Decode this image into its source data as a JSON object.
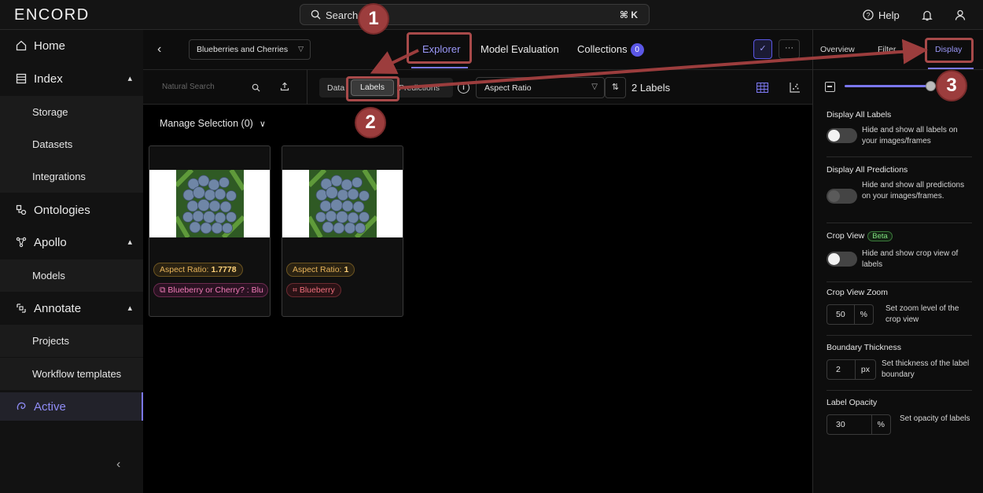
{
  "app": {
    "logo": "ENCORD",
    "search_label": "Search",
    "search_shortcut": "⌘ K",
    "help_label": "Help"
  },
  "sidebar": {
    "items": [
      {
        "label": "Home"
      },
      {
        "label": "Index"
      },
      {
        "label": "Storage"
      },
      {
        "label": "Datasets"
      },
      {
        "label": "Integrations"
      },
      {
        "label": "Ontologies"
      },
      {
        "label": "Apollo"
      },
      {
        "label": "Models"
      },
      {
        "label": "Annotate"
      },
      {
        "label": "Projects"
      },
      {
        "label": "Workflow templates"
      },
      {
        "label": "Active"
      }
    ]
  },
  "main": {
    "dataset": "Blueberries and Cherries",
    "tabs": [
      {
        "label": "Explorer"
      },
      {
        "label": "Model Evaluation"
      },
      {
        "label": "Collections",
        "badge": "0"
      }
    ],
    "natural_search_placeholder": "Natural Search",
    "segments": {
      "data": "Data",
      "labels": "Labels",
      "predictions": "Predictions"
    },
    "sort_field": "Aspect Ratio",
    "label_count": "2 Labels",
    "manage_selection": "Manage Selection (0)",
    "cards": [
      {
        "aspect_key": "Aspect Ratio:",
        "aspect_val": "1.7778",
        "label": "Blueberry or Cherry? : Blu"
      },
      {
        "aspect_key": "Aspect Ratio:",
        "aspect_val": "1",
        "label": "Blueberry"
      }
    ]
  },
  "right_panel": {
    "tabs": [
      {
        "label": "Overview"
      },
      {
        "label": "Filter"
      },
      {
        "label": "Display"
      }
    ],
    "sections": [
      {
        "title": "Display All Labels",
        "desc": "Hide and show all labels on your images/frames"
      },
      {
        "title": "Display All Predictions",
        "desc": "Hide and show all predictions on your images/frames."
      },
      {
        "title": "Crop View",
        "badge": "Beta",
        "desc": "Hide and show crop view of labels"
      },
      {
        "title": "Crop View Zoom",
        "value": "50",
        "unit": "%",
        "desc": "Set zoom level of the crop view"
      },
      {
        "title": "Boundary Thickness",
        "value": "2",
        "unit": "px",
        "desc": "Set thickness of the label boundary"
      },
      {
        "title": "Label Opacity",
        "value": "30",
        "unit": "%",
        "desc": "Set opacity of labels"
      }
    ]
  },
  "annotations": {
    "step1": "1",
    "step2": "2",
    "step3": "3"
  },
  "colors": {
    "accent": "#7b77f0",
    "callout": "#9c3d3d"
  }
}
